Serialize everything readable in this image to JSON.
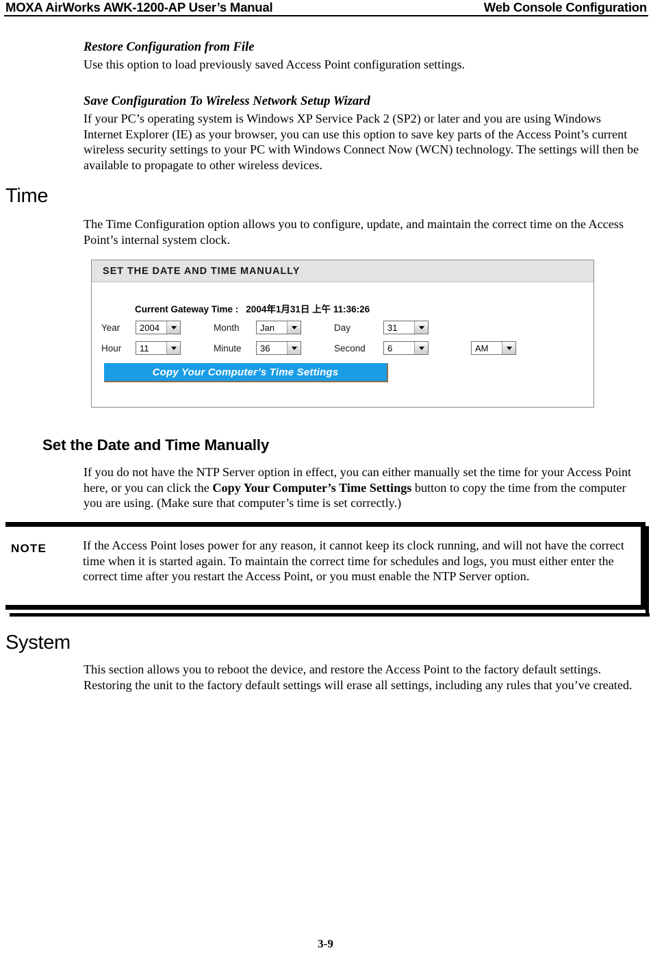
{
  "header": {
    "left_title": "MOXA AirWorks AWK-1200-AP User’s Manual",
    "right_title": "Web Console Configuration"
  },
  "content": {
    "restore_heading": "Restore Configuration from File",
    "restore_paragraph": "Use this option to load previously saved Access Point configuration settings.",
    "save_wizard_heading": "Save Configuration To Wireless Network Setup Wizard",
    "save_wizard_paragraph": "If your PC’s operating system is Windows XP Service Pack 2 (SP2) or later and you are using Windows Internet Explorer (IE) as your browser, you can use this option to save key parts of the Access Point’s current wireless security settings to your PC with Windows Connect Now (WCN) technology. The settings will then be available to propagate to other wireless devices.",
    "time_section_heading": "Time",
    "time_section_paragraph": "The Time Configuration option allows you to configure, update, and maintain the correct time on the Access Point’s internal system clock.",
    "manual_subsection_heading": "Set the Date and Time Manually",
    "manual_paragraph_part1": "If you do not have the NTP Server option in effect, you can either manually set the time for your Access Point here, or you can click the ",
    "manual_paragraph_bold": "Copy Your Computer’s Time Settings",
    "manual_paragraph_part2": " button to copy the time from the computer you are using. (Make sure that computer’s time is set correctly.)",
    "system_section_heading": "System",
    "system_section_paragraph": "This section allows you to reboot the device, and restore the Access Point to the factory default settings. Restoring the unit to the factory default settings will erase all settings, including any rules that you’ve created."
  },
  "note": {
    "label": "NOTE",
    "text": "If the Access Point loses power for any reason, it cannot keep its clock running, and will not have the correct time when it is started again. To maintain the correct time for schedules and logs, you must either enter the correct time after you restart the Access Point, or you must enable the NTP Server option."
  },
  "figure": {
    "panel_title": "SET THE DATE AND TIME MANUALLY",
    "current_time_label": "Current Gateway Time :",
    "current_time_value": "2004年1月31日 上午 11:36:26",
    "fields": {
      "year_label": "Year",
      "year_value": "2004",
      "month_label": "Month",
      "month_value": "Jan",
      "day_label": "Day",
      "day_value": "31",
      "hour_label": "Hour",
      "hour_value": "11",
      "minute_label": "Minute",
      "minute_value": "36",
      "second_label": "Second",
      "second_value": "6",
      "meridiem_value": "AM"
    },
    "copy_button_label": "Copy Your Computer’s Time Settings",
    "accent_color": "#1a9ce6",
    "titlebar_color": "#e3e3e3"
  },
  "footer": {
    "page_number": "3-9"
  }
}
